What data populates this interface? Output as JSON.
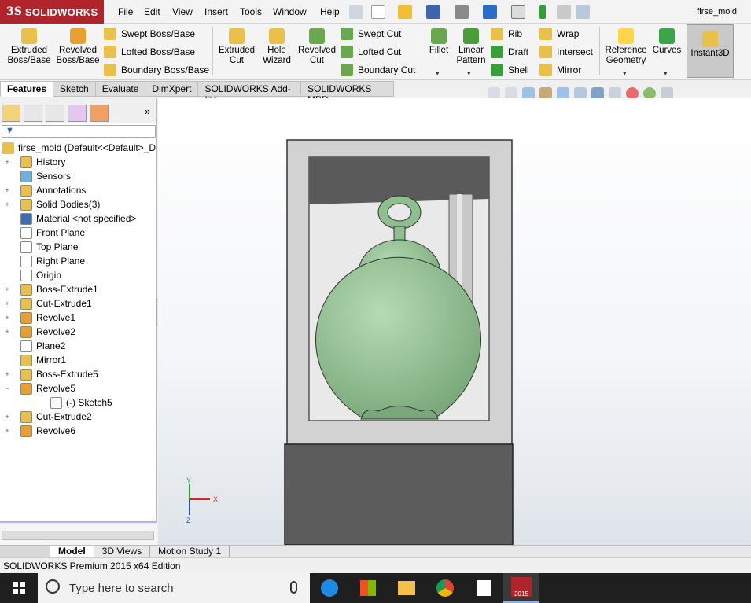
{
  "app": {
    "brand_ds": "3S",
    "brand": "SOLIDWORKS",
    "document_title": "firse_mold"
  },
  "menu": [
    "File",
    "Edit",
    "View",
    "Insert",
    "Tools",
    "Window",
    "Help"
  ],
  "ribbon": {
    "extruded_boss": [
      "Extruded",
      "Boss/Base"
    ],
    "revolved_boss": [
      "Revolved",
      "Boss/Base"
    ],
    "swept_boss": "Swept Boss/Base",
    "lofted_boss": "Lofted Boss/Base",
    "boundary_boss": "Boundary Boss/Base",
    "extruded_cut": [
      "Extruded",
      "Cut"
    ],
    "hole_wizard": [
      "Hole",
      "Wizard"
    ],
    "revolved_cut": [
      "Revolved",
      "Cut"
    ],
    "swept_cut": "Swept Cut",
    "lofted_cut": "Lofted Cut",
    "boundary_cut": "Boundary Cut",
    "fillet": "Fillet",
    "linear_pattern": [
      "Linear",
      "Pattern"
    ],
    "rib": "Rib",
    "draft": "Draft",
    "shell": "Shell",
    "wrap": "Wrap",
    "intersect": "Intersect",
    "mirror": "Mirror",
    "reference_geometry": [
      "Reference",
      "Geometry"
    ],
    "curves": "Curves",
    "instant3d": "Instant3D"
  },
  "tabs": [
    "Features",
    "Sketch",
    "Evaluate",
    "DimXpert",
    "SOLIDWORKS Add-Ins",
    "SOLIDWORKS MBD"
  ],
  "tree": {
    "root": "firse_mold  (Default<<Default>_D",
    "items": [
      {
        "label": "History",
        "icon": "history-icon",
        "color": "#e8c04a",
        "exp": "+"
      },
      {
        "label": "Sensors",
        "icon": "sensor-icon",
        "color": "#6fb0e0",
        "exp": ""
      },
      {
        "label": "Annotations",
        "icon": "annotation-icon",
        "color": "#e8c04a",
        "exp": "+"
      },
      {
        "label": "Solid Bodies(3)",
        "icon": "solid-bodies-icon",
        "color": "#e8c04a",
        "exp": "+"
      },
      {
        "label": "Material <not specified>",
        "icon": "material-icon",
        "color": "#3b6fb5",
        "exp": ""
      },
      {
        "label": "Front Plane",
        "icon": "plane-icon",
        "color": "#ffffff",
        "exp": ""
      },
      {
        "label": "Top Plane",
        "icon": "plane-icon",
        "color": "#ffffff",
        "exp": ""
      },
      {
        "label": "Right Plane",
        "icon": "plane-icon",
        "color": "#ffffff",
        "exp": ""
      },
      {
        "label": "Origin",
        "icon": "origin-icon",
        "color": "#ffffff",
        "exp": ""
      },
      {
        "label": "Boss-Extrude1",
        "icon": "boss-extrude-icon",
        "color": "#e8c04a",
        "exp": "+"
      },
      {
        "label": "Cut-Extrude1",
        "icon": "cut-extrude-icon",
        "color": "#e8c04a",
        "exp": "+"
      },
      {
        "label": "Revolve1",
        "icon": "revolve-icon",
        "color": "#e8a030",
        "exp": "+"
      },
      {
        "label": "Revolve2",
        "icon": "revolve-icon",
        "color": "#e8a030",
        "exp": "+"
      },
      {
        "label": "Plane2",
        "icon": "plane-icon",
        "color": "#ffffff",
        "exp": ""
      },
      {
        "label": "Mirror1",
        "icon": "mirror-icon",
        "color": "#e8c04a",
        "exp": ""
      },
      {
        "label": "Boss-Extrude5",
        "icon": "boss-extrude-icon",
        "color": "#e8c04a",
        "exp": "+"
      },
      {
        "label": "Revolve5",
        "icon": "revolve-icon",
        "color": "#e8a030",
        "exp": "−"
      },
      {
        "label": "(-) Sketch5",
        "icon": "sketch-icon",
        "color": "#ffffff",
        "exp": "",
        "indent": true
      },
      {
        "label": "Cut-Extrude2",
        "icon": "cut-extrude-icon",
        "color": "#e8c04a",
        "exp": "+"
      },
      {
        "label": "Revolve6",
        "icon": "revolve-icon",
        "color": "#e8a030",
        "exp": "+"
      }
    ]
  },
  "bottom_tabs": [
    "Model",
    "3D Views",
    "Motion Study 1"
  ],
  "status": "SOLIDWORKS Premium 2015 x64 Edition",
  "taskbar": {
    "search_placeholder": "Type here to search",
    "sw_badge": "2015"
  },
  "triad": {
    "y": "Y",
    "x": "X",
    "z": "Z"
  },
  "colors": {
    "brand_red": "#b0252b",
    "part_green": "#8fbf8f",
    "mold_gray": "#d2d2d2",
    "mold_dark": "#5a5a5a"
  }
}
